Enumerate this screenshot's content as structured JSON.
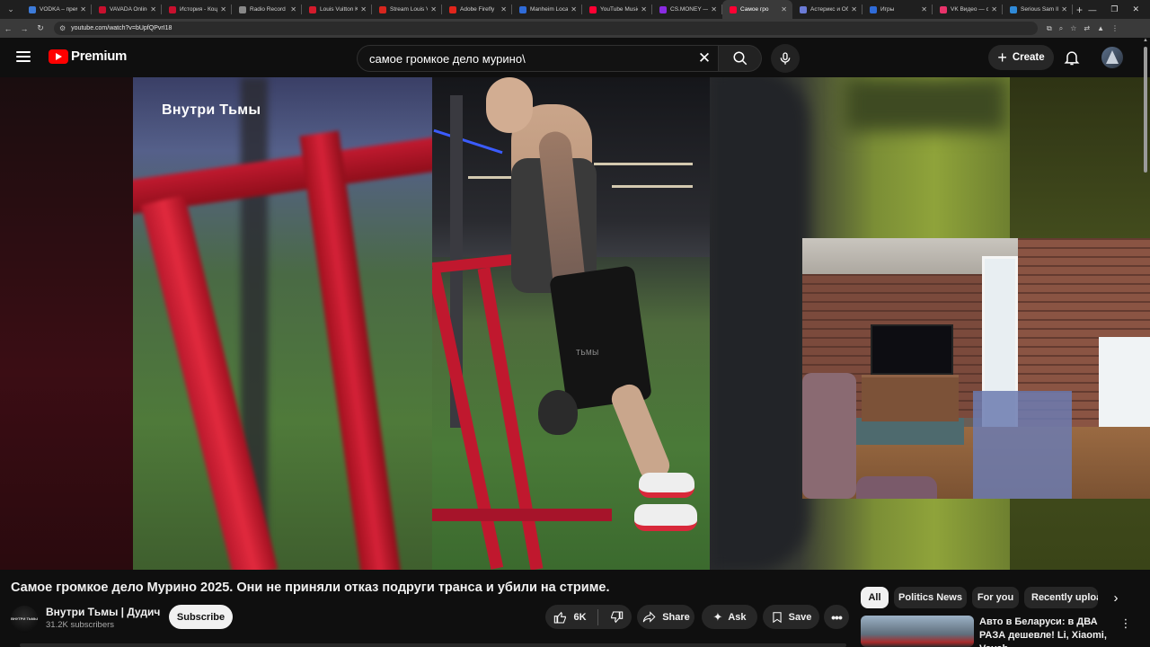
{
  "browser": {
    "tabs": [
      {
        "title": "VODKA – прем",
        "color": "#3d7bd9"
      },
      {
        "title": "VAVADA Online",
        "color": "#c8102e"
      },
      {
        "title": "История - Коц",
        "color": "#c8102e"
      },
      {
        "title": "Radio Record",
        "color": "#888888"
      },
      {
        "title": "Louis Vuitton K",
        "color": "#d41b2c"
      },
      {
        "title": "Stream Louis V",
        "color": "#d7261e"
      },
      {
        "title": "Adobe Firefly",
        "color": "#e1251b"
      },
      {
        "title": "Manheim Locat",
        "color": "#2f6bd8"
      },
      {
        "title": "YouTube Music",
        "color": "#ff0033"
      },
      {
        "title": "CS.MONEY —",
        "color": "#8a2be2"
      },
      {
        "title": "Самое гро",
        "color": "#ff0033",
        "active": true
      },
      {
        "title": "Астерикс и Об",
        "color": "#6b7bd6"
      },
      {
        "title": "Игры",
        "color": "#2f6bd8"
      },
      {
        "title": "VK Видео — с",
        "color": "#e8336a"
      },
      {
        "title": "Serious Sam II",
        "color": "#2f8ad8"
      }
    ],
    "new_tab": "+",
    "url": "youtube.com/watch?v=bUpfQPvrI18"
  },
  "header": {
    "logo_text": "Premium",
    "search_value": "самое громкое дело мурино\\",
    "create_label": "Create"
  },
  "video": {
    "watermark": "Внутри Тьмы",
    "frame_watermark": "ТЬМЫ"
  },
  "info": {
    "title": "Самое громкое дело Мурино 2025. Они не приняли отказ подруги транса и убили на стриме.",
    "channel_name": "Внутри Тьмы | Дудич",
    "subscribers": "31.2K subscribers",
    "avatar_text": "ВНУТРИ ТЬМЫ",
    "subscribe_label": "Subscribe",
    "likes": "6K",
    "share_label": "Share",
    "ask_label": "Ask",
    "save_label": "Save"
  },
  "sidebar": {
    "chips": [
      "All",
      "Politics News",
      "For you",
      "Recently uploa"
    ],
    "recommendation_title": "Авто в Беларуси: в ДВА РАЗА дешевле! Li, Xiaomi, Voyah, ..."
  },
  "colors": {
    "accent": "#ff0000",
    "background": "#0f0f0f"
  }
}
